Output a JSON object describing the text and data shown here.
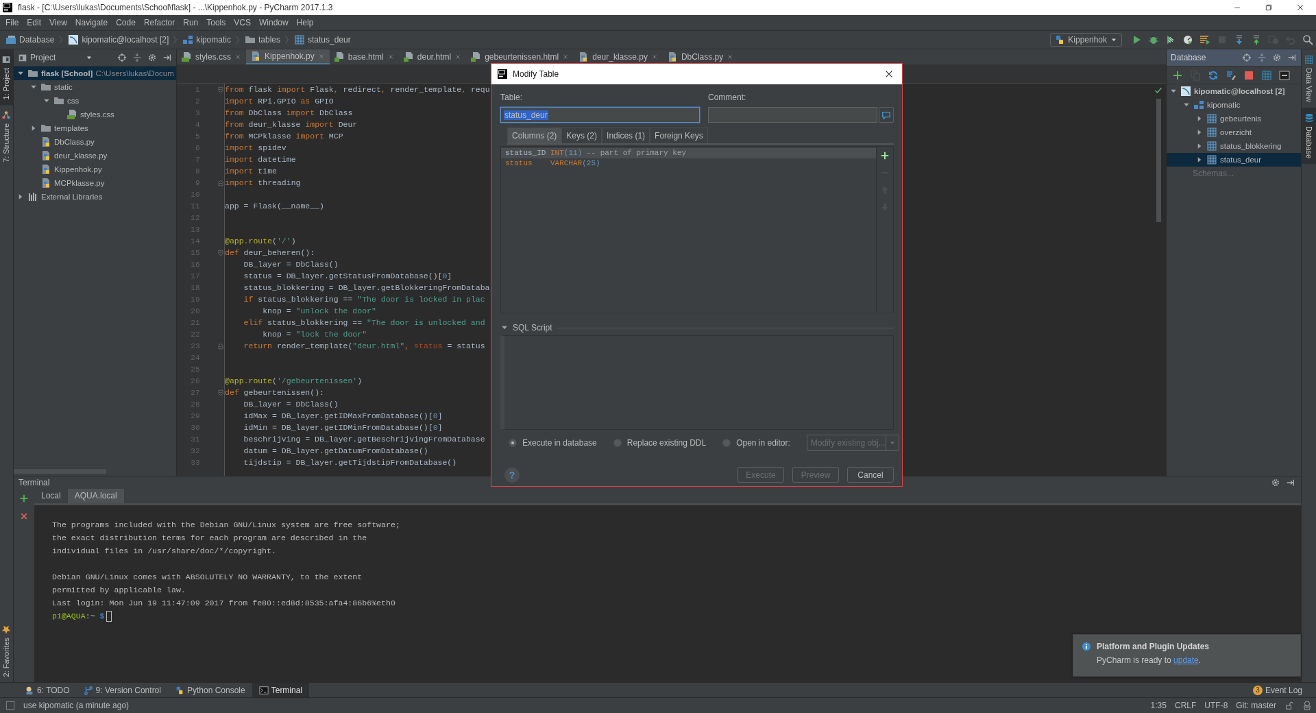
{
  "window": {
    "title": "flask - [C:\\Users\\lukas\\Documents\\School\\flask] - ...\\Kippenhok.py - PyCharm 2017.1.3"
  },
  "menu": [
    "File",
    "Edit",
    "View",
    "Navigate",
    "Code",
    "Refactor",
    "Run",
    "Tools",
    "VCS",
    "Window",
    "Help"
  ],
  "breadcrumbs": [
    {
      "label": "Database",
      "kind": "database"
    },
    {
      "label": "kipomatic@localhost [2]",
      "kind": "connection"
    },
    {
      "label": "kipomatic",
      "kind": "schema"
    },
    {
      "label": "tables",
      "kind": "folder"
    },
    {
      "label": "status_deur",
      "kind": "table"
    }
  ],
  "run_config": {
    "label": "Kippenhok"
  },
  "toolbar": [
    {
      "kind": "run",
      "disabled": false
    },
    {
      "kind": "debug",
      "disabled": false
    },
    {
      "kind": "coverage",
      "disabled": false
    },
    {
      "kind": "profile",
      "disabled": false
    },
    {
      "kind": "tasks",
      "disabled": false
    },
    {
      "kind": "stop",
      "disabled": true
    },
    {
      "kind": "vcs-update",
      "disabled": false
    },
    {
      "kind": "vcs-commit",
      "disabled": false
    },
    {
      "kind": "history",
      "disabled": true
    },
    {
      "kind": "revert",
      "disabled": true
    },
    {
      "kind": "search",
      "disabled": false
    }
  ],
  "left_tool_tabs": [
    {
      "label": "1: Project",
      "kind": "project",
      "selected": true
    },
    {
      "label": "7: Structure",
      "kind": "structure",
      "selected": false
    }
  ],
  "favorites_tab": {
    "label": "2: Favorites"
  },
  "project_panel": {
    "title": "Project",
    "tree": [
      {
        "label": "flask [School]",
        "path": "C:\\Users\\lukas\\Docum",
        "kind": "folder",
        "expanded": true,
        "selected": true,
        "children": [
          {
            "label": "static",
            "kind": "folder",
            "expanded": true,
            "selected": false,
            "children": [
              {
                "label": "css",
                "kind": "folder",
                "expanded": true,
                "selected": false,
                "children": [
                  {
                    "label": "styles.css",
                    "kind": "css",
                    "selected": false
                  }
                ]
              }
            ]
          },
          {
            "label": "templates",
            "kind": "folder",
            "expanded": false,
            "selected": false
          },
          {
            "label": "DbClass.py",
            "kind": "python",
            "selected": false
          },
          {
            "label": "deur_klasse.py",
            "kind": "python",
            "selected": false
          },
          {
            "label": "Kippenhok.py",
            "kind": "python",
            "selected": false
          },
          {
            "label": "MCPklasse.py",
            "kind": "python",
            "selected": false
          }
        ]
      },
      {
        "label": "External Libraries",
        "kind": "library",
        "expanded": false,
        "selected": false
      }
    ]
  },
  "editor": {
    "tabs": [
      {
        "label": "styles.css",
        "kind": "css",
        "selected": false
      },
      {
        "label": "Kippenhok.py",
        "kind": "python",
        "selected": true
      },
      {
        "label": "base.html",
        "kind": "html",
        "selected": false
      },
      {
        "label": "deur.html",
        "kind": "html",
        "selected": false
      },
      {
        "label": "gebeurtenissen.html",
        "kind": "html",
        "selected": false
      },
      {
        "label": "deur_klasse.py",
        "kind": "python",
        "selected": false
      },
      {
        "label": "DbClass.py",
        "kind": "python",
        "selected": false
      }
    ],
    "lines": [
      {
        "number": "1",
        "fold_start": true,
        "segments": [
          {
            "kind": "keyword",
            "text": "from"
          },
          {
            "kind": "plain",
            "text": " flask "
          },
          {
            "kind": "keyword",
            "text": "import"
          },
          {
            "kind": "plain",
            "text": " Flask"
          },
          {
            "kind": "keyword",
            "text": ","
          },
          {
            "kind": "plain",
            "text": " redirect"
          },
          {
            "kind": "keyword",
            "text": ","
          },
          {
            "kind": "plain",
            "text": " render_template"
          },
          {
            "kind": "keyword",
            "text": ","
          },
          {
            "kind": "plain",
            "text": " requ"
          }
        ]
      },
      {
        "number": "2",
        "segments": [
          {
            "kind": "keyword",
            "text": "import"
          },
          {
            "kind": "plain",
            "text": " RPi.GPIO "
          },
          {
            "kind": "keyword",
            "text": "as"
          },
          {
            "kind": "plain",
            "text": " GPIO"
          }
        ]
      },
      {
        "number": "3",
        "segments": [
          {
            "kind": "keyword",
            "text": "from"
          },
          {
            "kind": "plain",
            "text": " DbClass "
          },
          {
            "kind": "keyword",
            "text": "import"
          },
          {
            "kind": "plain",
            "text": " DbClass"
          }
        ]
      },
      {
        "number": "4",
        "segments": [
          {
            "kind": "keyword",
            "text": "from"
          },
          {
            "kind": "plain",
            "text": " deur_klasse "
          },
          {
            "kind": "keyword",
            "text": "import"
          },
          {
            "kind": "plain",
            "text": " Deur"
          }
        ]
      },
      {
        "number": "5",
        "segments": [
          {
            "kind": "keyword",
            "text": "from"
          },
          {
            "kind": "plain",
            "text": " MCPklasse "
          },
          {
            "kind": "keyword",
            "text": "import"
          },
          {
            "kind": "plain",
            "text": " MCP"
          }
        ]
      },
      {
        "number": "6",
        "segments": [
          {
            "kind": "keyword",
            "text": "import"
          },
          {
            "kind": "plain",
            "text": " spidev"
          }
        ]
      },
      {
        "number": "7",
        "segments": [
          {
            "kind": "keyword",
            "text": "import"
          },
          {
            "kind": "plain",
            "text": " datetime"
          }
        ]
      },
      {
        "number": "8",
        "segments": [
          {
            "kind": "keyword",
            "text": "import"
          },
          {
            "kind": "plain",
            "text": " time"
          }
        ]
      },
      {
        "number": "9",
        "fold_end": true,
        "segments": [
          {
            "kind": "keyword",
            "text": "import"
          },
          {
            "kind": "plain",
            "text": " threading"
          }
        ]
      },
      {
        "number": "10"
      },
      {
        "number": "11",
        "segments": [
          {
            "kind": "plain",
            "text": "app = Flask(__name__)"
          }
        ]
      },
      {
        "number": "12"
      },
      {
        "number": "13"
      },
      {
        "number": "14",
        "segments": [
          {
            "kind": "decorator",
            "text": "@app.route"
          },
          {
            "kind": "plain",
            "text": "("
          },
          {
            "kind": "string",
            "text": "'/'"
          },
          {
            "kind": "plain",
            "text": ")"
          }
        ]
      },
      {
        "number": "15",
        "fold_start": true,
        "segments": [
          {
            "kind": "keyword",
            "text": "def"
          },
          {
            "kind": "plain",
            "text": " deur_beheren():"
          }
        ]
      },
      {
        "number": "16",
        "segments": [
          {
            "kind": "plain",
            "text": "    DB_layer = DbClass()"
          }
        ]
      },
      {
        "number": "17",
        "segments": [
          {
            "kind": "plain",
            "text": "    status = DB_layer.getStatusFromDatabase()["
          },
          {
            "kind": "number",
            "text": "0"
          },
          {
            "kind": "plain",
            "text": "]"
          }
        ]
      },
      {
        "number": "18",
        "segments": [
          {
            "kind": "plain",
            "text": "    status_blokkering = DB_layer.getBlokkeringFromDataba"
          }
        ]
      },
      {
        "number": "19",
        "segments": [
          {
            "kind": "keyword",
            "text": "    if"
          },
          {
            "kind": "plain",
            "text": " status_blokkering == "
          },
          {
            "kind": "string",
            "text": "\"The door is locked in plac"
          }
        ]
      },
      {
        "number": "20",
        "segments": [
          {
            "kind": "plain",
            "text": "        knop = "
          },
          {
            "kind": "string",
            "text": "\"unlock the door\""
          }
        ]
      },
      {
        "number": "21",
        "segments": [
          {
            "kind": "keyword",
            "text": "    elif"
          },
          {
            "kind": "plain",
            "text": " status_blokkering == "
          },
          {
            "kind": "string",
            "text": "\"The door is unlocked and"
          }
        ]
      },
      {
        "number": "22",
        "segments": [
          {
            "kind": "plain",
            "text": "        knop = "
          },
          {
            "kind": "string",
            "text": "\"lock the door\""
          }
        ]
      },
      {
        "number": "23",
        "fold_end": true,
        "segments": [
          {
            "kind": "keyword",
            "text": "    return"
          },
          {
            "kind": "plain",
            "text": " render_template("
          },
          {
            "kind": "string",
            "text": "\"deur.html\""
          },
          {
            "kind": "keyword",
            "text": ","
          },
          {
            "kind": "param",
            "text": " status"
          },
          {
            "kind": "plain",
            "text": " = status"
          }
        ]
      },
      {
        "number": "24"
      },
      {
        "number": "25"
      },
      {
        "number": "26",
        "segments": [
          {
            "kind": "decorator",
            "text": "@app.route"
          },
          {
            "kind": "plain",
            "text": "("
          },
          {
            "kind": "string",
            "text": "'/gebeurtenissen'"
          },
          {
            "kind": "plain",
            "text": ")"
          }
        ]
      },
      {
        "number": "27",
        "fold_start": true,
        "segments": [
          {
            "kind": "keyword",
            "text": "def"
          },
          {
            "kind": "plain",
            "text": " gebeurtenissen():"
          }
        ]
      },
      {
        "number": "28",
        "segments": [
          {
            "kind": "plain",
            "text": "    DB_layer = DbClass()"
          }
        ]
      },
      {
        "number": "29",
        "segments": [
          {
            "kind": "plain",
            "text": "    idMax = DB_layer.getIDMaxFromDatabase()["
          },
          {
            "kind": "number",
            "text": "0"
          },
          {
            "kind": "plain",
            "text": "]"
          }
        ]
      },
      {
        "number": "30",
        "segments": [
          {
            "kind": "plain",
            "text": "    idMin = DB_layer.getIDMinFromDatabase()["
          },
          {
            "kind": "number",
            "text": "0"
          },
          {
            "kind": "plain",
            "text": "]"
          }
        ]
      },
      {
        "number": "31",
        "segments": [
          {
            "kind": "plain",
            "text": "    beschrijving = DB_layer.getBeschrijvingFromDatabase"
          }
        ]
      },
      {
        "number": "32",
        "segments": [
          {
            "kind": "plain",
            "text": "    datum = DB_layer.getDatumFromDatabase()"
          }
        ]
      },
      {
        "number": "33",
        "segments": [
          {
            "kind": "plain",
            "text": "    tijdstip = DB_layer.getTijdstipFromDatabase()"
          }
        ]
      }
    ]
  },
  "database_panel": {
    "title": "Database",
    "tools": [
      {
        "kind": "add",
        "disabled": false
      },
      {
        "kind": "copy",
        "disabled": true
      },
      {
        "kind": "refresh",
        "disabled": false
      },
      {
        "kind": "wrench",
        "disabled": false
      },
      {
        "kind": "stop",
        "disabled": false
      },
      {
        "kind": "table",
        "disabled": false
      },
      {
        "kind": "console",
        "disabled": false
      }
    ],
    "tree": [
      {
        "label": "kipomatic@localhost [2]",
        "kind": "connection",
        "expanded": true,
        "selected": false,
        "children": [
          {
            "label": "kipomatic",
            "kind": "schema",
            "expanded": true,
            "selected": false,
            "children": [
              {
                "label": "gebeurtenis",
                "kind": "table",
                "expanded": false,
                "selected": false
              },
              {
                "label": "overzicht",
                "kind": "table",
                "expanded": false,
                "selected": false
              },
              {
                "label": "status_blokkering",
                "kind": "table",
                "expanded": false,
                "selected": false
              },
              {
                "label": "status_deur",
                "kind": "table",
                "expanded": false,
                "selected": true
              }
            ]
          }
        ]
      }
    ],
    "footer": "Schemas..."
  },
  "right_tool_tabs": [
    {
      "label": "Data View",
      "kind": "grid",
      "selected": false
    },
    {
      "label": "Database",
      "kind": "database",
      "selected": true
    }
  ],
  "terminal": {
    "title": "Terminal",
    "tabs": [
      {
        "label": "Local",
        "selected": false
      },
      {
        "label": "AQUA.local",
        "selected": true
      }
    ],
    "paragraphs": [
      [
        "The programs included with the Debian GNU/Linux system are free software;",
        "the exact distribution terms for each program are described in the",
        "individual files in /usr/share/doc/*/copyright."
      ],
      [
        "Debian GNU/Linux comes with ABSOLUTELY NO WARRANTY, to the extent",
        "permitted by applicable law.",
        "Last login: Mon Jun 19 11:47:09 2017 from fe80::ed8d:8535:afa4:86b6%eth0"
      ]
    ],
    "prompt": {
      "user": "pi@AQUA",
      "path": ":~",
      "symbol": "$"
    }
  },
  "dialog": {
    "title": "Modify Table",
    "table_label": "Table:",
    "table_value": "status_deur",
    "comment_label": "Comment:",
    "tabs": [
      {
        "label": "Columns (2)",
        "selected": true
      },
      {
        "label": "Keys (2)",
        "selected": false
      },
      {
        "label": "Indices (1)",
        "selected": false
      },
      {
        "label": "Foreign Keys",
        "selected": false
      }
    ],
    "columns": [
      {
        "selected": true,
        "segments": [
          {
            "kind": "plain",
            "text": "status_ID "
          },
          {
            "kind": "keyword",
            "text": "INT"
          },
          {
            "kind": "number",
            "text": "(11)"
          },
          {
            "kind": "comment",
            "text": " -- part of primary key"
          }
        ]
      },
      {
        "selected": false,
        "segments": [
          {
            "kind": "keyword",
            "text": "status    VARCHAR"
          },
          {
            "kind": "number",
            "text": "(25)"
          }
        ]
      }
    ],
    "list_tools": [
      {
        "kind": "add",
        "disabled": false
      },
      {
        "kind": "remove",
        "disabled": true
      },
      {
        "kind": "up",
        "disabled": true
      },
      {
        "kind": "down",
        "disabled": true
      }
    ],
    "sql_section": {
      "label": "SQL Script",
      "expanded": true
    },
    "options": [
      {
        "label": "Execute in database",
        "selected": true
      },
      {
        "label": "Replace existing DDL",
        "selected": false
      },
      {
        "label": "Open in editor:",
        "selected": false
      }
    ],
    "target_dropdown": {
      "value": "Modify existing obj...",
      "disabled": true
    },
    "help_button": "?",
    "buttons": [
      {
        "label": "Execute",
        "disabled": true
      },
      {
        "label": "Preview",
        "disabled": true
      },
      {
        "label": "Cancel",
        "disabled": false
      }
    ]
  },
  "notification": {
    "title": "Platform and Plugin Updates",
    "text": "PyCharm is ready to ",
    "link": "update",
    "end": "."
  },
  "bottom_tabs": [
    {
      "label": "6: TODO",
      "kind": "todo",
      "selected": false
    },
    {
      "label": "9: Version Control",
      "kind": "vcs",
      "selected": false
    },
    {
      "label": "Python Console",
      "kind": "python",
      "selected": false
    },
    {
      "label": "Terminal",
      "kind": "terminal",
      "selected": true
    }
  ],
  "event_log": {
    "label": "Event Log",
    "count": "3"
  },
  "status_bar": {
    "message": "use kipomatic (a minute ago)",
    "position": "1:35",
    "line_separator": "CRLF",
    "encoding": "UTF-8",
    "branch": "Git: master"
  }
}
